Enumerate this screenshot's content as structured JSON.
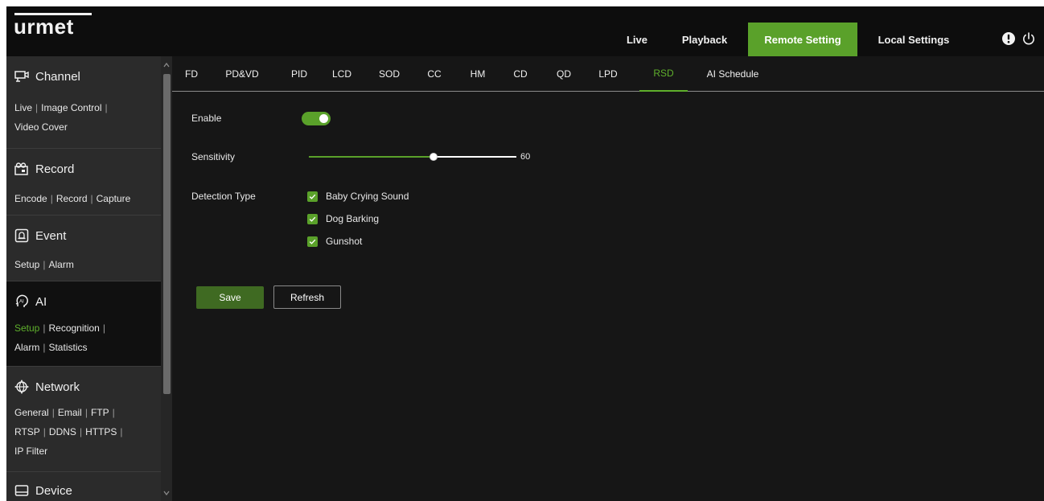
{
  "app": {
    "logo": "urmet"
  },
  "topnav": {
    "items": [
      {
        "label": "Live"
      },
      {
        "label": "Playback"
      },
      {
        "label": "Remote Setting"
      },
      {
        "label": "Local Settings"
      }
    ],
    "active": "Remote Setting",
    "icons": [
      "info-icon",
      "power-icon"
    ]
  },
  "sidebar": {
    "sections": [
      {
        "title": "Channel",
        "icon": "channel-icon",
        "lines": [
          [
            "Live",
            "Image Control"
          ],
          [
            "Video Cover"
          ]
        ]
      },
      {
        "title": "Record",
        "icon": "record-icon",
        "lines": [
          [
            "Encode",
            "Record",
            "Capture"
          ]
        ]
      },
      {
        "title": "Event",
        "icon": "event-icon",
        "lines": [
          [
            "Setup",
            "Alarm"
          ]
        ]
      },
      {
        "title": "AI",
        "icon": "ai-icon",
        "lines": [
          [
            "Setup",
            "Recognition"
          ],
          [
            "Alarm",
            "Statistics"
          ]
        ],
        "active_link": "Setup"
      },
      {
        "title": "Network",
        "icon": "network-icon",
        "lines": [
          [
            "General",
            "Email",
            "FTP"
          ],
          [
            "RTSP",
            "DDNS",
            "HTTPS"
          ],
          [
            "IP Filter"
          ]
        ]
      },
      {
        "title": "Device",
        "icon": "device-icon",
        "lines": []
      }
    ],
    "active_section": "AI"
  },
  "tabs": {
    "items": [
      "FD",
      "PD&VD",
      "PID",
      "LCD",
      "SOD",
      "CC",
      "HM",
      "CD",
      "QD",
      "LPD",
      "RSD",
      "AI Schedule"
    ],
    "active": "RSD"
  },
  "form": {
    "enable_label": "Enable",
    "enable_value": true,
    "sensitivity_label": "Sensitivity",
    "sensitivity_value": "60",
    "sensitivity_fraction": 0.6,
    "detection_type_label": "Detection Type",
    "detection_types": [
      {
        "label": "Baby Crying Sound",
        "checked": true
      },
      {
        "label": "Dog Barking",
        "checked": true
      },
      {
        "label": "Gunshot",
        "checked": true
      }
    ]
  },
  "buttons": {
    "save": "Save",
    "refresh": "Refresh"
  },
  "colors": {
    "accent": "#5aa12a",
    "background": "#161616",
    "sidebar": "#2b2b2b",
    "topbar": "#0d0d0d"
  }
}
